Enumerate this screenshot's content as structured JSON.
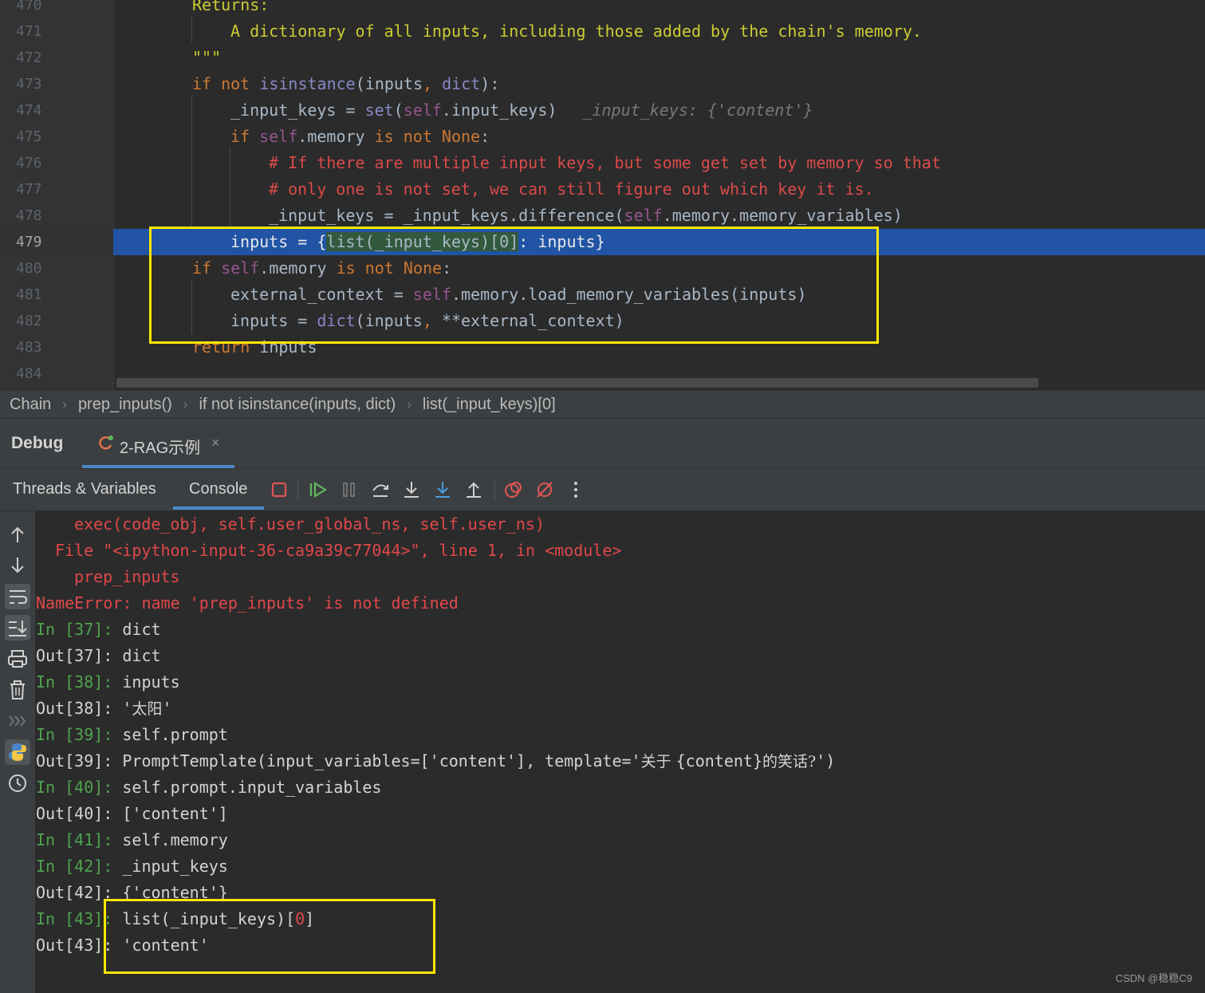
{
  "editor": {
    "line_numbers": [
      "470",
      "471",
      "472",
      "473",
      "474",
      "475",
      "476",
      "477",
      "478",
      "479",
      "480",
      "481",
      "482",
      "483",
      "484"
    ],
    "current_line": "479",
    "code": {
      "l470_returns": "Returns:",
      "l471_doc": "A dictionary of all inputs, including those added by the chain's memory.",
      "l472_quotes": "\"\"\"",
      "l473_if": "if",
      "l473_not": " not ",
      "l473_isinstance": "isinstance",
      "l473_open": "(inputs",
      "l473_comma": ", ",
      "l473_dict": "dict",
      "l473_close": "):",
      "l474_lhs": "_input_keys = ",
      "l474_set": "set",
      "l474_open": "(",
      "l474_self": "self",
      "l474_rest": ".input_keys)",
      "l474_inlay": "_input_keys: {'content'}",
      "l475_if": "if ",
      "l475_self": "self",
      "l475_mem": ".memory ",
      "l475_isnot": "is not ",
      "l475_none": "None",
      "l475_colon": ":",
      "l476_comment": "# If there are multiple input keys, but some get set by memory so that",
      "l477_comment": "# only one is not set, we can still figure out which key it is.",
      "l478_lhs": "_input_keys = _input_keys.difference(",
      "l478_self": "self",
      "l478_rest": ".memory.memory_variables)",
      "l479_lhs": "inputs = {",
      "l479_hl": "list(_input_keys)[0]",
      "l479_rest": ": inputs}",
      "l480_if": "if ",
      "l480_self": "self",
      "l480_mem": ".memory ",
      "l480_isnot": "is not ",
      "l480_none": "None",
      "l480_colon": ":",
      "l481_lhs": "external_context = ",
      "l481_self": "self",
      "l481_rest": ".memory.load_memory_variables(inputs)",
      "l482_lhs": "inputs = ",
      "l482_dict": "dict",
      "l482_open": "(inputs",
      "l482_comma": ", ",
      "l482_rest": "**external_context)",
      "l483_return": "return",
      "l483_rest": " inputs"
    }
  },
  "breadcrumb": [
    "Chain",
    "prep_inputs()",
    "if not isinstance(inputs, dict)",
    "list(_input_keys)[0]"
  ],
  "breadcrumb_separator": "›",
  "debug": {
    "title": "Debug",
    "session_tab": "2-RAG示例",
    "close_glyph": "×",
    "tabs": [
      "Threads & Variables",
      "Console"
    ],
    "active_tab": "Console"
  },
  "console": {
    "l1": "exec(code_obj, self.user_global_ns, self.user_ns)",
    "l2": "File \"<ipython-input-36-ca9a39c77044>\", line 1, in <module>",
    "l3": "prep_inputs",
    "l4": "NameError: name 'prep_inputs' is not defined",
    "in37": "In [37]:",
    "in37_cmd": " dict",
    "out37": "Out[37]:",
    "out37_val": " dict",
    "in38": "In [38]:",
    "in38_cmd": " inputs",
    "out38": "Out[38]:",
    "out38_val_a": " '",
    "out38_val_b": "太阳",
    "out38_val_c": "'",
    "in39": "In [39]:",
    "in39_cmd": " self.prompt",
    "out39": "Out[39]:",
    "out39_val_a": " PromptTemplate(input_variables=['content'], template='",
    "out39_val_b": "关于 ",
    "out39_val_c": "{content}",
    "out39_val_d": "的笑话?",
    "out39_val_e": "')",
    "in40": "In [40]:",
    "in40_cmd": " self.prompt.input_variables",
    "out40": "Out[40]:",
    "out40_val": " ['content']",
    "in41": "In [41]:",
    "in41_cmd": " self.memory",
    "in42": "In [42]:",
    "in42_cmd": " _input_keys",
    "out42": "Out[42]:",
    "out42_val": " {'content'}",
    "in43": "In [43]:",
    "in43_cmd_a": " list(_input_keys)[",
    "in43_cmd_b": "0",
    "in43_cmd_c": "]",
    "out43": "Out[43]:",
    "out43_val": " 'content'"
  },
  "watermark": "CSDN @稳稳C9",
  "colors": {
    "keyword": "#cc7832",
    "builtin": "#8888c6",
    "self": "#94558d",
    "docstring": "#cccc33",
    "comment": "#d94a4a",
    "execution_line": "#2154a5",
    "annotation_box": "#ffe600",
    "prompt_green": "#4fa34f",
    "error_red": "#e0484b"
  }
}
